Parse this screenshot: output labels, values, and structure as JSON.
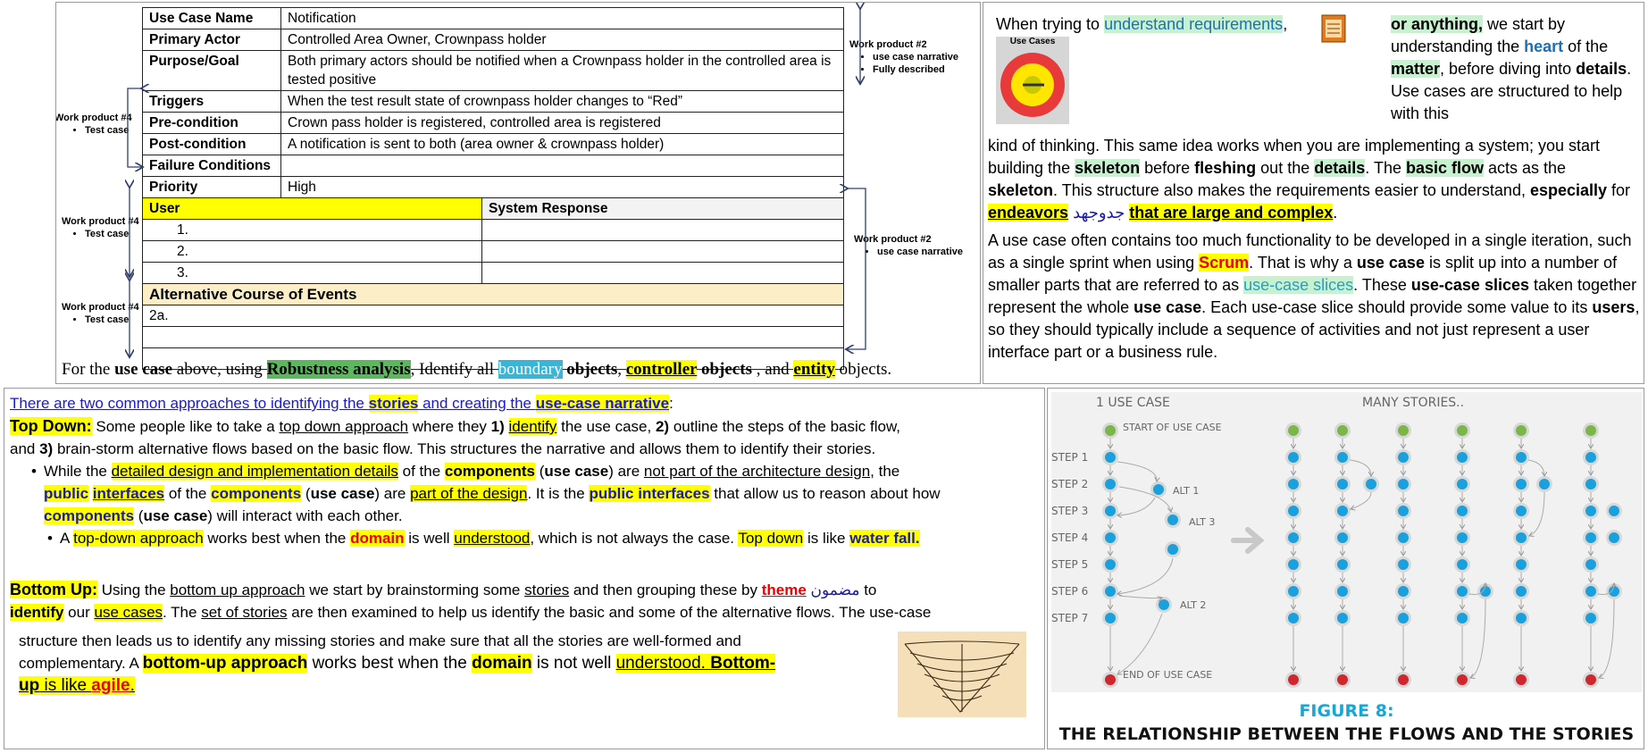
{
  "use_case_table": {
    "rows": [
      {
        "key": "Use Case Name",
        "value": "Notification"
      },
      {
        "key": "Primary Actor",
        "value": "Controlled Area Owner, Crownpass holder"
      },
      {
        "key": "Purpose/Goal",
        "value": "Both primary actors should be notified when a Crownpass holder in the controlled area is tested positive"
      },
      {
        "key": "Triggers",
        "value": "When the test result state of crownpass holder changes to “Red”"
      },
      {
        "key": "Pre-condition",
        "value": "Crown pass holder is registered, controlled area is registered"
      },
      {
        "key": "Post-condition",
        "value": "A notification is sent to both (area owner & crownpass holder)"
      },
      {
        "key": "Failure Conditions",
        "value": ""
      },
      {
        "key": "Priority",
        "value": "High"
      }
    ],
    "flow_header_user": "User",
    "flow_header_system": "System Response",
    "steps": [
      "1.",
      "2.",
      "3."
    ],
    "alt_header": "Alternative Course of Events",
    "alt_first": "2a.",
    "work_products": {
      "wp2_top_title": "Work product #2",
      "wp2_top_items": [
        "use case narrative",
        "Fully described"
      ],
      "wp4_a_title": "Work product #4",
      "wp4_a_item": "Test case",
      "wp4_b_title": "Work product #4",
      "wp4_b_item": "Test case",
      "wp4_c_title": "Work product #4",
      "wp4_c_item": "Test case",
      "wp2_mid_title": "Work product #2",
      "wp2_mid_item": "use case narrative"
    },
    "question": {
      "p1": "For the ",
      "p2": "use case",
      "p3": " above, using ",
      "p4": "Robustness analysis",
      "p5": ", Identify all ",
      "p6": "boundary",
      "p7": " objects",
      "p8": ", ",
      "p9": "controller",
      "p10": " objects",
      "p11": " , and ",
      "p12": "entity",
      "p13": " objects."
    }
  },
  "right_text": {
    "a1": "When trying to ",
    "a2": "understand requirements",
    "a3": "or anything,",
    "a4": " we start by understanding the ",
    "a5": "heart",
    "a6": " of the ",
    "a7": "matter",
    "a8": ", before diving into ",
    "a9": "details",
    "a10": ". Use cases are structured to help with this",
    "b1": "kind of thinking. This same idea works when you are implementing a system; you start building the ",
    "b2": "skeleton",
    "b3": " before ",
    "b4": "fleshing",
    "b5": " out the ",
    "b6": "details",
    "b7": ". The ",
    "b8": "basic flow",
    "b9": " acts as the ",
    "b10": "skeleton",
    "b11": ". This structure also makes the requirements easier to understand, ",
    "b12": "especially",
    "b13": " for ",
    "b14": "endeavors",
    "b15": "جدوجهد",
    "b16": "that are large and complex",
    "b17": ".",
    "c1": "A use case often contains too much functionality to be developed in a single iteration, such as a single sprint when using ",
    "c2": "Scrum",
    "c3": ". That is why a ",
    "c4": "use case",
    "c5": " is split up into a number of smaller parts that are referred to as ",
    "c6": "use-case slices",
    "c7": ". These ",
    "c8": "use-case slices",
    "c9": " taken together represent the whole ",
    "c10": "use case",
    "c11": ". Each use-case slice should provide some value to its ",
    "c12": "users",
    "c13": ", so they should typically include a sequence of activities and not just represent a user interface part or a business rule.",
    "image_label": "Use Cases"
  },
  "approaches": {
    "l1a": "There are two common approaches to identifying the ",
    "l1b": "stories",
    "l1c": " and creating the ",
    "l1d": "use-case narrative",
    "l1e": ":",
    "td_head": "Top Down:",
    "td1": " Some people like to take a ",
    "td2": "top down approach",
    "td3": " where they ",
    "td4": "1)",
    "td5": "identify",
    "td6": " the use case, ",
    "td7": "2)",
    "td8": " outline the steps of the basic flow,",
    "td9": "and ",
    "td10": "3)",
    "td11": " brain-storm alternative flows based on the basic flow. This structures the narrative and allows them to identify their stories.",
    "bu1_1": "While the ",
    "bu1_2": "detailed design and implementation details",
    "bu1_3": " of the ",
    "bu1_4": "components",
    "bu1_5": " (",
    "bu1_6": "use case",
    "bu1_7": ") are ",
    "bu1_8": "not part of the architecture design",
    "bu1_9": ", the",
    "bu1_10": "public",
    "bu1_11": "interfaces",
    "bu1_12": " of the ",
    "bu1_13": "components",
    "bu1_14": " (",
    "bu1_15": "use case",
    "bu1_16": ") are ",
    "bu1_17": "part of the design",
    "bu1_18": ". It is the ",
    "bu1_19": "public interfaces",
    "bu1_20": " that allow us to reason about how",
    "bu1_21": "components",
    "bu1_22": " (",
    "bu1_23": "use case",
    "bu1_24": ") will interact with each other.",
    "bu2_1": "A ",
    "bu2_2": "top-down approach",
    "bu2_3": " works best when the ",
    "bu2_4": "domain",
    "bu2_5": " is well ",
    "bu2_6": "understood",
    "bu2_7": ", which is not always the case. ",
    "bu2_8": "Top down",
    "bu2_9": " is like ",
    "bu2_10": "water fall.",
    "bp_head": "Bottom Up:",
    "bp1": " Using the ",
    "bp2": "bottom up approach",
    "bp3": " we start by brainstorming some ",
    "bp4": "stories",
    "bp5": " and then grouping these by ",
    "bp6": "theme",
    "bp7": " مضمون",
    "bp8": " to",
    "bp9": "identify",
    "bp10": " our ",
    "bp11": "use cases",
    "bp12": ". The ",
    "bp13": "set of stories",
    "bp14": " are then examined to help us identify the basic and some of the alternative flows. The use-case",
    "bp15": "structure then leads us to identify any missing stories and make sure that all the stories are well-formed and",
    "bp16": "complementary. A ",
    "bp17": "bottom-up approach",
    "bp18": " works best when the ",
    "bp19": "domain",
    "bp20": " is not well ",
    "bp21": "understood.",
    "bp22": " Bottom-",
    "bp23": "up",
    "bp24": " is like ",
    "bp25": "agile",
    "bp26": "."
  },
  "figure": {
    "title_left": "1 USE CASE",
    "title_right": "MANY STORIES..",
    "start": "START OF USE CASE",
    "end": "END OF USE CASE",
    "steps": [
      "STEP 1",
      "STEP 2",
      "STEP 3",
      "STEP 4",
      "STEP 5",
      "STEP 6",
      "STEP 7"
    ],
    "alts": [
      "ALT 1",
      "ALT 3",
      "ALT 2"
    ],
    "caption1": "FIGURE 8:",
    "caption2": "THE RELATIONSHIP BETWEEN THE FLOWS AND THE STORIES",
    "colors": {
      "start": "#7ab648",
      "step": "#1aa0dc",
      "end": "#d0262e"
    }
  }
}
